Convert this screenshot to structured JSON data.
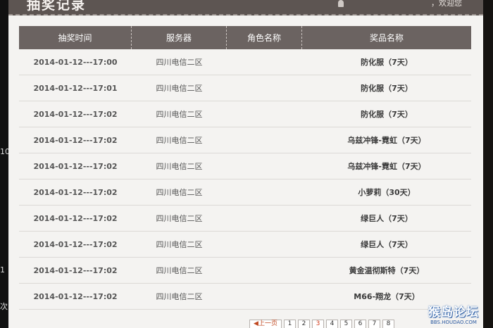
{
  "window": {
    "title": "抽奖记录",
    "greeting": "，欢迎您"
  },
  "table": {
    "headers": [
      "抽奖时间",
      "服务器",
      "角色名称",
      "奖品名称"
    ],
    "rows": [
      {
        "time": "2014-01-12---17:00",
        "server": "四川电信二区",
        "role": "",
        "prize": "防化服（7天）"
      },
      {
        "time": "2014-01-12---17:01",
        "server": "四川电信二区",
        "role": "",
        "prize": "防化服（7天）"
      },
      {
        "time": "2014-01-12---17:02",
        "server": "四川电信二区",
        "role": "",
        "prize": "防化服（7天）"
      },
      {
        "time": "2014-01-12---17:02",
        "server": "四川电信二区",
        "role": "",
        "prize": "乌兹冲锋-霓虹（7天）"
      },
      {
        "time": "2014-01-12---17:02",
        "server": "四川电信二区",
        "role": "",
        "prize": "乌兹冲锋-霓虹（7天）"
      },
      {
        "time": "2014-01-12---17:02",
        "server": "四川电信二区",
        "role": "",
        "prize": "小萝莉（30天）"
      },
      {
        "time": "2014-01-12---17:02",
        "server": "四川电信二区",
        "role": "",
        "prize": "绿巨人（7天）"
      },
      {
        "time": "2014-01-12---17:02",
        "server": "四川电信二区",
        "role": "",
        "prize": "绿巨人（7天）"
      },
      {
        "time": "2014-01-12---17:02",
        "server": "四川电信二区",
        "role": "",
        "prize": "黄金温彻斯特（7天）"
      },
      {
        "time": "2014-01-12---17:02",
        "server": "四川电信二区",
        "role": "",
        "prize": "M66-翔龙（7天）"
      }
    ]
  },
  "pagination": {
    "prev_label": "上一页",
    "pages": [
      "1",
      "2",
      "3",
      "4",
      "5",
      "6",
      "7",
      "8"
    ],
    "current": "3"
  },
  "watermark": {
    "main": "猴岛论坛",
    "sub": "BBS.HOUDAO.COM"
  },
  "background": {
    "left_fragments": [
      "10",
      "1",
      "次"
    ]
  }
}
